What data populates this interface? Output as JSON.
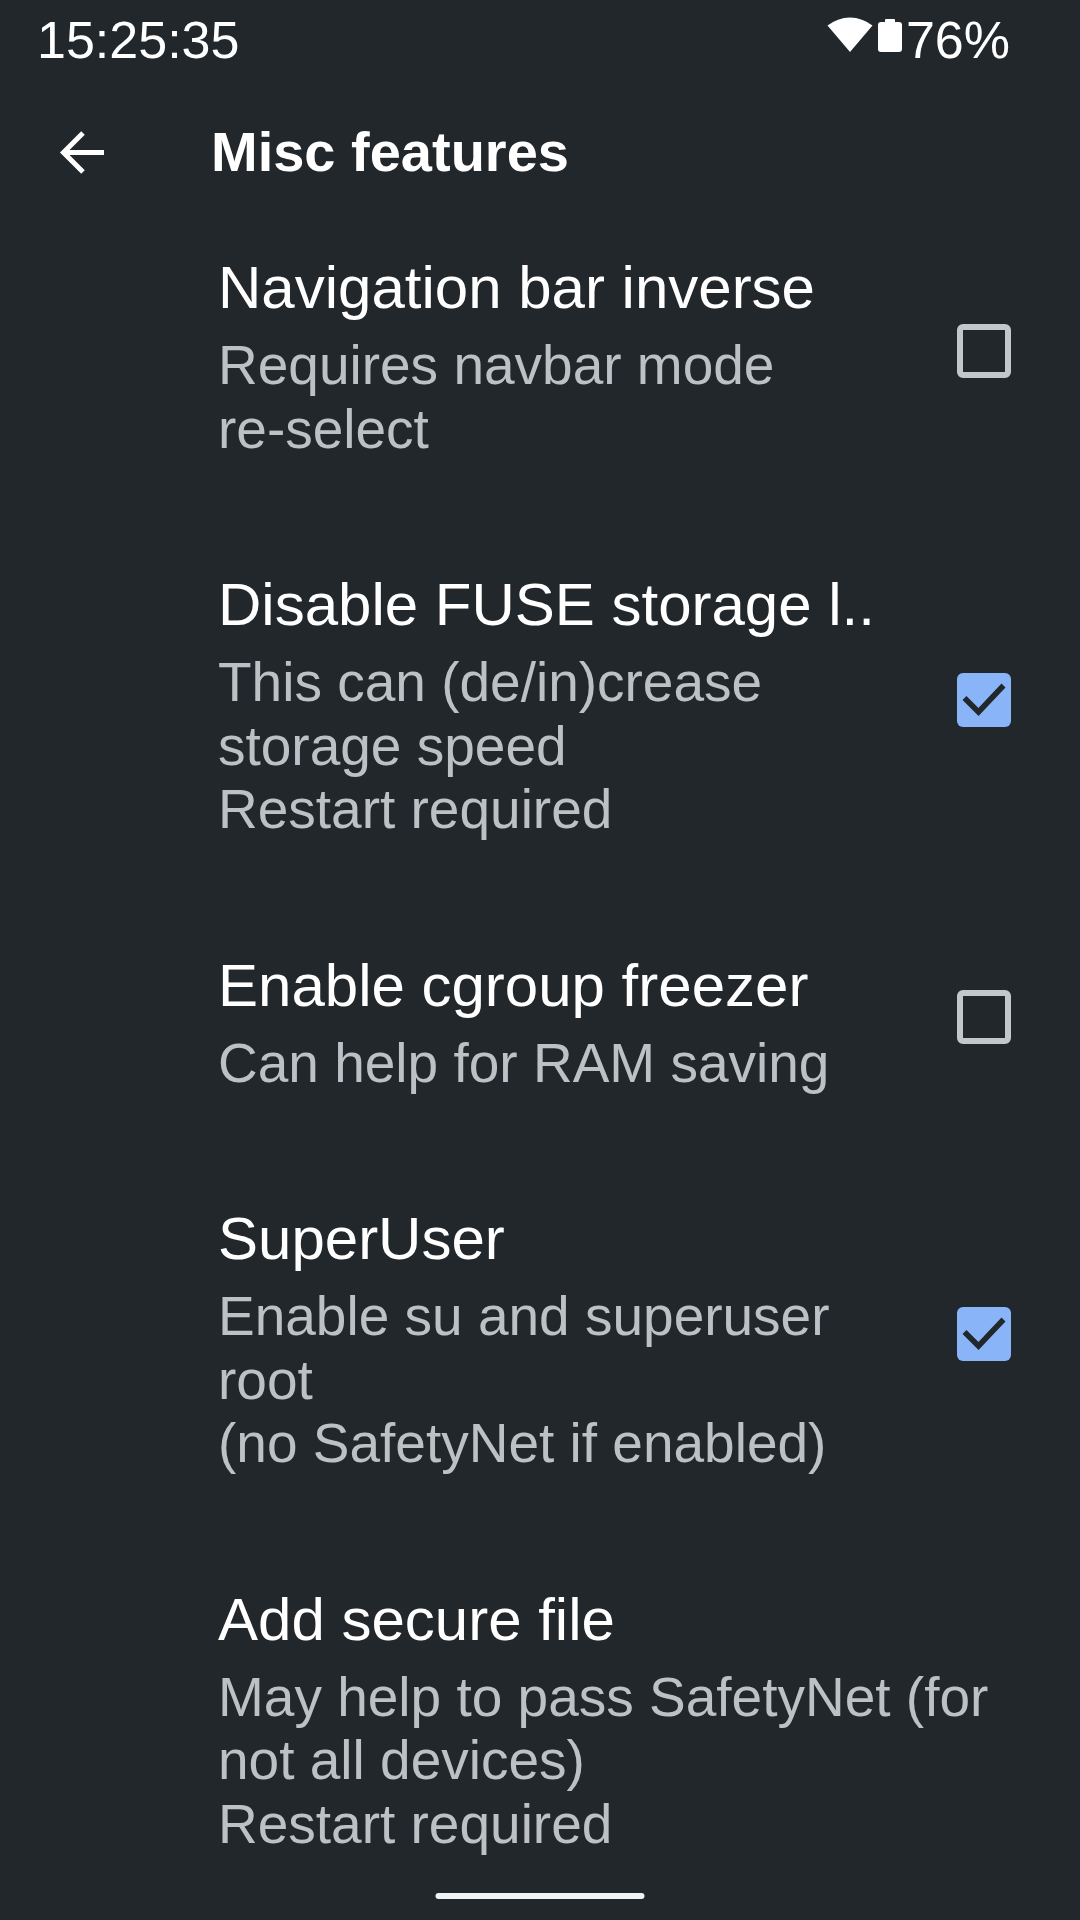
{
  "status_bar": {
    "time": "15:25:35",
    "battery": "76%"
  },
  "toolbar": {
    "title": "Misc features"
  },
  "preferences": [
    {
      "kind": "checkbox",
      "title": "Navigation bar inverse",
      "summary": "Requires navbar mode re-select",
      "checked": false
    },
    {
      "kind": "checkbox",
      "title": "Disable FUSE storage l..",
      "summary": "This can (de/in)crease storage speed\nRestart required",
      "checked": true
    },
    {
      "kind": "checkbox",
      "title": "Enable cgroup freezer",
      "summary": "Can help for RAM saving",
      "checked": false
    },
    {
      "kind": "checkbox",
      "title": "SuperUser",
      "summary": "Enable su and superuser root\n(no SafetyNet if enabled)",
      "checked": true
    },
    {
      "kind": "text",
      "title": "Add secure file",
      "summary": "May help to pass SafetyNet (for not all devices)\nRestart required"
    }
  ]
}
